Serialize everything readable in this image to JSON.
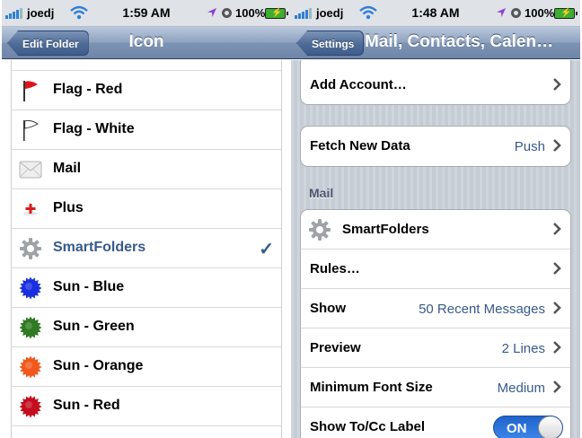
{
  "colors": {
    "nav_bar": "#7d93b3",
    "selected_text": "#375a8c",
    "value_text": "#375a8c",
    "grouped_bg": "#c5ccd4",
    "toggle_on": "#2f78e0"
  },
  "left": {
    "statusbar": {
      "carrier": "joedj",
      "time": "1:59 AM",
      "battery": "100%"
    },
    "navbar": {
      "back": "Edit Folder",
      "title": "Icon"
    },
    "items": [
      {
        "label": "Flag - Red",
        "icon": "red-flag-icon",
        "selected": false
      },
      {
        "label": "Flag - White",
        "icon": "white-flag-icon",
        "selected": false
      },
      {
        "label": "Mail",
        "icon": "mail-envelope-icon",
        "selected": false
      },
      {
        "label": "Plus",
        "icon": "plus-icon",
        "selected": false
      },
      {
        "label": "SmartFolders",
        "icon": "gear-icon",
        "selected": true
      },
      {
        "label": "Sun - Blue",
        "icon": "blue-sun-icon",
        "color": "#1a2fe0",
        "selected": false
      },
      {
        "label": "Sun - Green",
        "icon": "green-sun-icon",
        "color": "#2f7a22",
        "selected": false
      },
      {
        "label": "Sun - Orange",
        "icon": "orange-sun-icon",
        "color": "#f0581e",
        "selected": false
      },
      {
        "label": "Sun - Red",
        "icon": "red-sun-icon",
        "color": "#c40e1e",
        "selected": false
      }
    ],
    "checkmark": "✓"
  },
  "right": {
    "statusbar": {
      "carrier": "joedj",
      "time": "1:48 AM",
      "battery": "100%"
    },
    "navbar": {
      "back": "Settings",
      "title": "Mail, Contacts, Calen…"
    },
    "add_account": "Add Account…",
    "fetch": {
      "label": "Fetch New Data",
      "value": "Push"
    },
    "section_mail": "Mail",
    "mail_rows": [
      {
        "label": "SmartFolders",
        "value": "",
        "icon": "gear-icon"
      },
      {
        "label": "Rules…",
        "value": ""
      },
      {
        "label": "Show",
        "value": "50 Recent Messages"
      },
      {
        "label": "Preview",
        "value": "2 Lines"
      },
      {
        "label": "Minimum Font Size",
        "value": "Medium"
      }
    ],
    "tocc": {
      "label": "Show To/Cc Label",
      "toggle": "ON"
    }
  }
}
